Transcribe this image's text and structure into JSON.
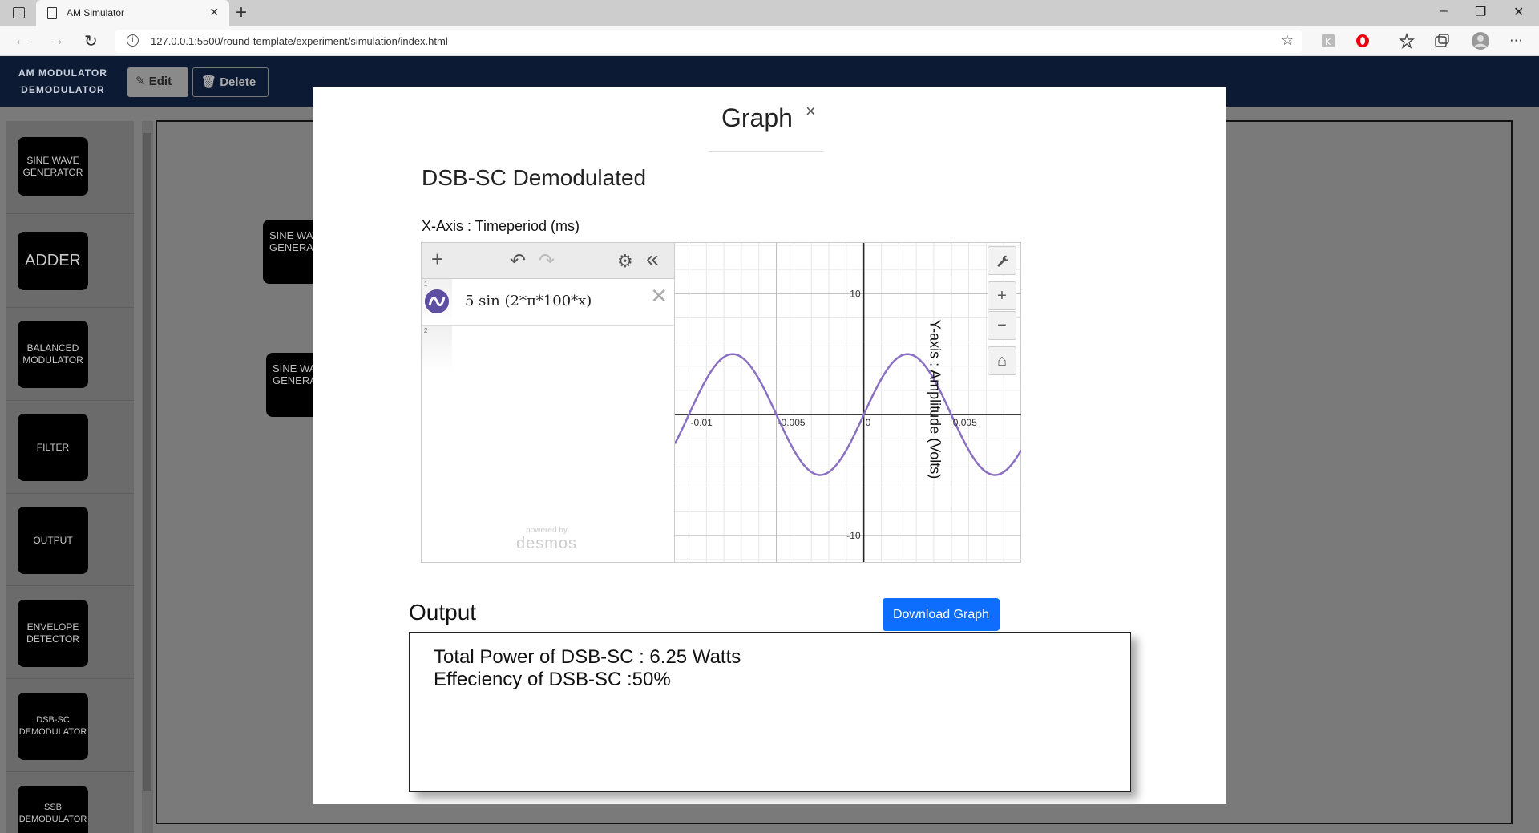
{
  "browser": {
    "tab_title": "AM Simulator",
    "tab_close": "×",
    "new_tab": "+",
    "url": "127.0.0.1:5500/round-template/experiment/simulation/index.html",
    "minimize": "–",
    "restore": "❐",
    "close": "✕",
    "back": "←",
    "forward": "→",
    "reload": "↻",
    "info": "i",
    "star": "☆"
  },
  "app": {
    "brand_line1": "AM MODULATOR",
    "brand_line2": "DEMODULATOR",
    "edit_label": "✎ Edit",
    "delete_label": "🗑 Delete"
  },
  "sidebar": {
    "items": [
      {
        "label": "SINE WAVE GENERATOR"
      },
      {
        "label": "ADDER"
      },
      {
        "label": "BALANCED MODULATOR"
      },
      {
        "label": "FILTER"
      },
      {
        "label": "OUTPUT"
      },
      {
        "label": "ENVELOPE DETECTOR"
      },
      {
        "label": "DSB-SC DEMODULATOR"
      },
      {
        "label": "SSB DEMODULATOR"
      }
    ]
  },
  "canvas": {
    "nodes": [
      {
        "label": "SINE WAVE GENERATOR"
      },
      {
        "label": "SINE WAVE GENERATOR"
      }
    ]
  },
  "modal": {
    "title": "Graph",
    "close": "×",
    "heading": "DSB-SC Demodulated",
    "x_axis_label": "X-Axis : Timeperiod (ms)",
    "y_axis_label": "Y-axis : Amplitude (Volts)",
    "calculator": {
      "expression": "5 sin (2*π*100*x)",
      "row1": "1",
      "row2": "2",
      "delete": "✕",
      "add": "+",
      "undo": "↶",
      "redo": "↷",
      "settings": "⚙",
      "collapse": "«",
      "powered_by": "powered by",
      "brand": "desmos",
      "wrench": "🔧",
      "zoom_in": "+",
      "zoom_out": "−",
      "home": "⌂"
    },
    "output_title": "Output",
    "download_label": "Download Graph",
    "output_lines": [
      "Total Power of DSB-SC : 6.25 Watts",
      "Effeciency of DSB-SC :50%"
    ]
  },
  "chart_data": {
    "type": "line",
    "function": "5 sin (2*π*100*x)",
    "amplitude": 5,
    "frequency": 100,
    "xlim": [
      -0.0108,
      0.009
    ],
    "ylim": [
      -12.2,
      14.2
    ],
    "x_ticks": [
      -0.01,
      -0.005,
      0,
      0.005
    ],
    "x_tick_labels": [
      "-0.01",
      "-0.005",
      "0",
      "0.005"
    ],
    "y_ticks": [
      -10,
      10
    ],
    "y_tick_labels": [
      "-10",
      "10"
    ],
    "grid": true,
    "line_color": "#8a6fc2"
  }
}
